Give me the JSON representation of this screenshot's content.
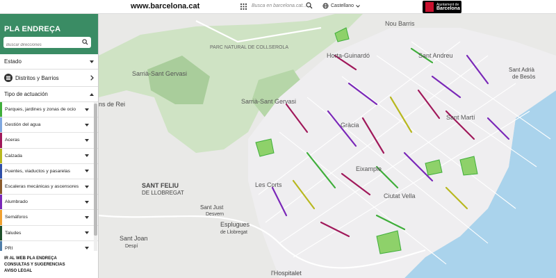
{
  "topbar": {
    "site": "www.barcelona.cat",
    "search_placeholder": "Busca en barcelona.cat...",
    "language": "Castellano",
    "logo_line1": "Ajuntament de",
    "logo_line2": "Barcelona"
  },
  "sidebar": {
    "title": "PLA ENDREÇA",
    "search_placeholder": "Buscar direcciones",
    "estado_label": "Estado",
    "distritos_label": "Distritos y Barrios",
    "tipo_label": "Tipo de actuación",
    "categories": [
      {
        "label": "Parques, jardines y zonas de ocio",
        "color": "#3fae3a"
      },
      {
        "label": "Gestión del agua",
        "color": "#7fa7df"
      },
      {
        "label": "Aceras",
        "color": "#a0185a"
      },
      {
        "label": "Calzada",
        "color": "#b8b81f"
      },
      {
        "label": "Puentes, viaductos y pasarelas",
        "color": "#2f4fa8"
      },
      {
        "label": "Escaleras mecánicas y ascensores",
        "color": "#8a5a2b"
      },
      {
        "label": "Alumbrado",
        "color": "#7a27b8"
      },
      {
        "label": "Semáforos",
        "color": "#f0a030"
      },
      {
        "label": "Taludes",
        "color": "#1d4f2a"
      },
      {
        "label": "PRI",
        "color": "#4f7da8"
      }
    ],
    "links": [
      "IR AL WEB PLA ENDREÇA",
      "CONSULTAS Y SUGERENCIAS",
      "AVISO LEGAL"
    ]
  },
  "map": {
    "labels": {
      "nou_barris": "Nou Barris",
      "horta": "Horta-Guinardó",
      "sant_andreu": "Sant Andreu",
      "sant_adria": "Sant Adrià",
      "de_besos": "de Besòs",
      "sarria": "Sarrià-Sant Gervasi",
      "sarria2": "Sarrià-Sant Gervasi",
      "parc": "PARC NATURAL DE COLLSEROLA",
      "gracia": "Gràcia",
      "sant_marti": "Sant Martí",
      "eixample": "Eixample",
      "les_corts": "Les Corts",
      "ciutat_vella": "Ciutat Vella",
      "sant_feliu": "SANT FELIU",
      "de_llobregat": "DE LLOBREGAT",
      "sant_just": "Sant Just",
      "desvern": "Desvern",
      "esplugues": "Esplugues",
      "de_llobregat2": "de Llobregat",
      "sant_joan": "Sant Joan",
      "despi": "Despí",
      "hospitalet": "l'Hospitalet",
      "ns_de_rei": "ns de Rei"
    }
  }
}
